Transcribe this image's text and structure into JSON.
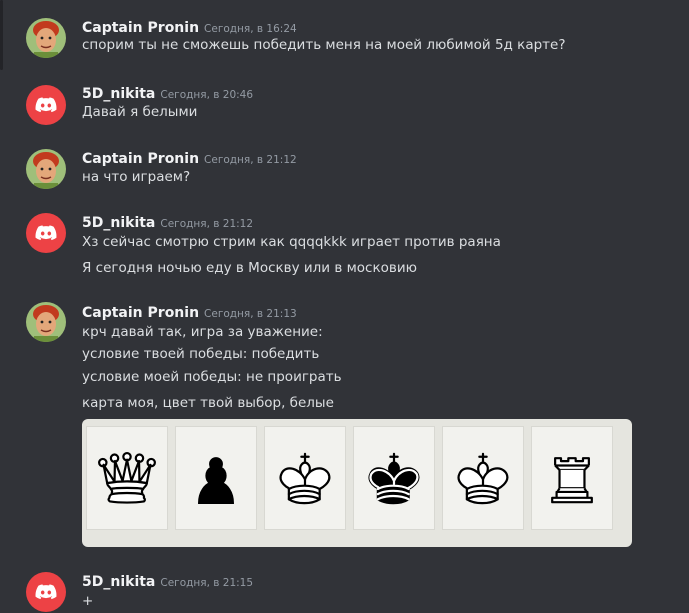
{
  "messages": [
    {
      "author": "Captain Pronin",
      "time": "Сегодня, в 16:24",
      "avatar": "captain-pronin-avatar",
      "lines": [
        "спорим ты не сможешь победить меня на моей любимой 5д карте?"
      ]
    },
    {
      "author": "5D_nikita",
      "time": "Сегодня, в 20:46",
      "avatar": "discord-default-avatar",
      "lines": [
        "Давай я белыми"
      ]
    },
    {
      "author": "Captain Pronin",
      "time": "Сегодня, в 21:12",
      "avatar": "captain-pronin-avatar",
      "lines": [
        "на что играем?"
      ]
    },
    {
      "author": "5D_nikita",
      "time": "Сегодня, в 21:12",
      "avatar": "discord-default-avatar",
      "lines": [
        "Хз сейчас смотрю стрим как qqqqkkk  играет против раяна",
        "Я сегодня ночью еду в Москву или в московию"
      ]
    },
    {
      "author": "Captain Pronin",
      "time": "Сегодня, в 21:13",
      "avatar": "captain-pronin-avatar",
      "lines": [
        "крч давай так, игра за уважение:",
        "условие твоей победы: победить",
        "условие моей победы: не проиграть",
        "карта моя, цвет твой выбор, белые"
      ]
    },
    {
      "author": "5D_nikita",
      "time": "Сегодня, в 21:15",
      "avatar": "discord-default-avatar",
      "lines": [
        "+"
      ]
    }
  ],
  "embed": {
    "pieces": [
      "white-queen-icon",
      "black-pawn-icon",
      "white-king-icon",
      "black-king-icon",
      "white-king-icon",
      "white-rook-icon"
    ]
  },
  "colors": {
    "background": "#313338",
    "discord_red": "#ed4245",
    "embed_background": "#e5e5df"
  }
}
